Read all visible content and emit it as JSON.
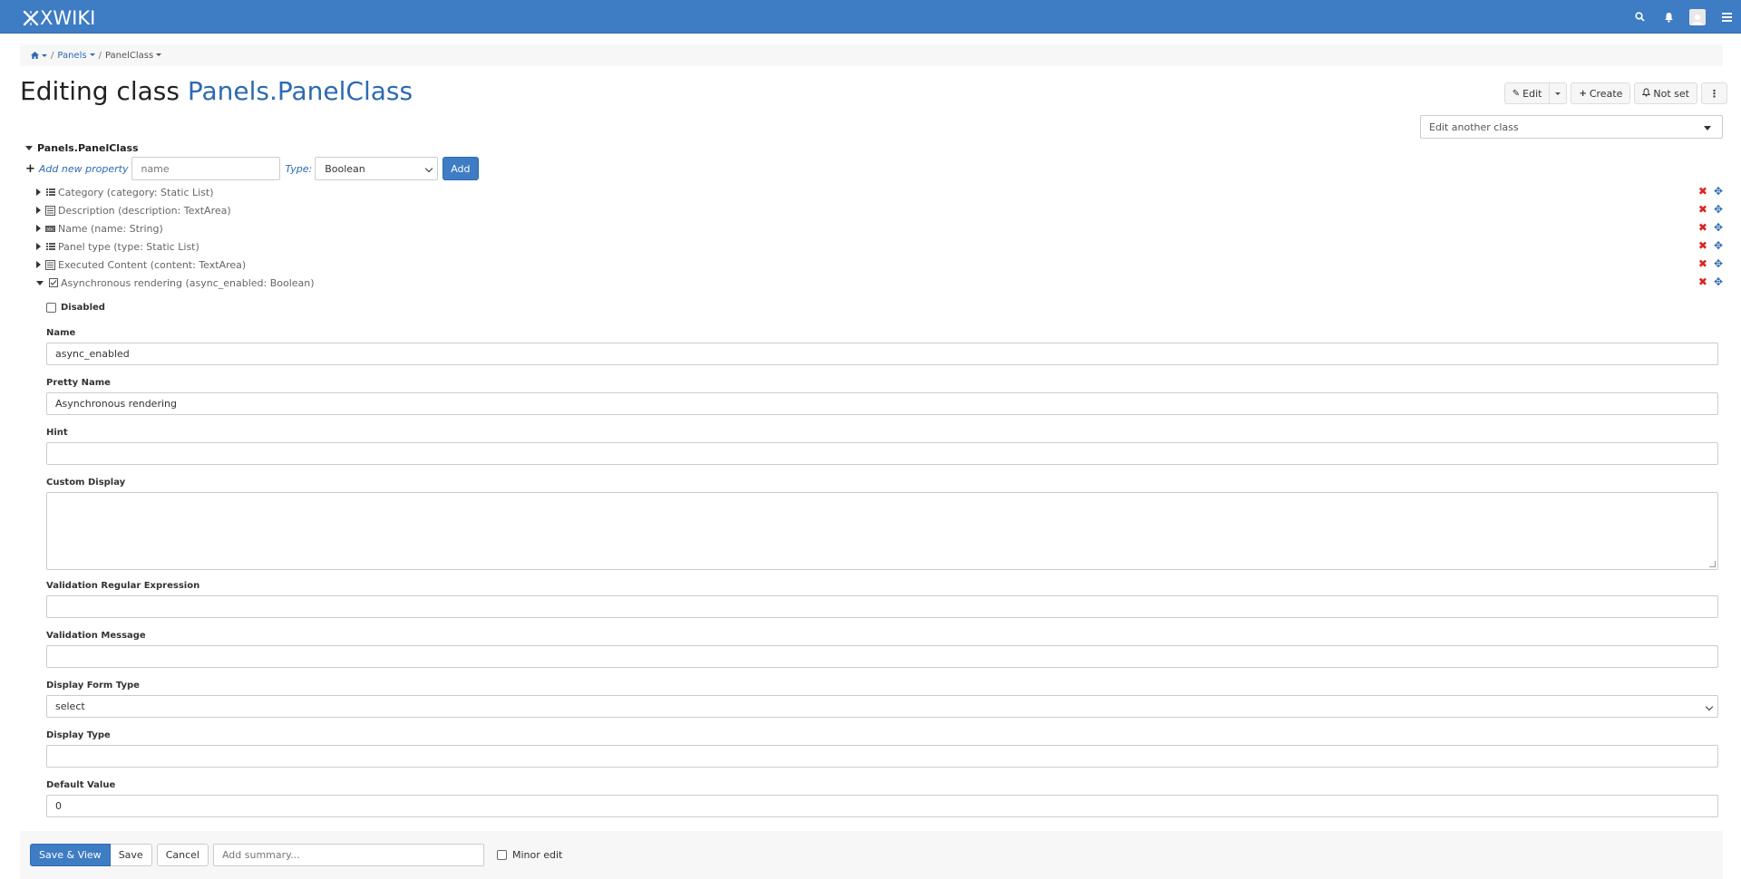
{
  "brand": "XWIKI",
  "breadcrumb": {
    "space": "Panels",
    "page": "PanelClass"
  },
  "title": {
    "prefix": "Editing class",
    "class_name": "Panels.PanelClass"
  },
  "actions": {
    "edit": "Edit",
    "create": "Create",
    "notify": "Not set"
  },
  "edit_another": "Edit another class",
  "class_root": "Panels.PanelClass",
  "add_property": {
    "link": "Add new property",
    "placeholder": "name",
    "type_label": "Type:",
    "type_value": "Boolean",
    "add": "Add"
  },
  "properties": [
    {
      "label": "Category (category: Static List)",
      "icon": "list-icon"
    },
    {
      "label": "Description (description: TextArea)",
      "icon": "textarea-icon"
    },
    {
      "label": "Name (name: String)",
      "icon": "string-icon"
    },
    {
      "label": "Panel type (type: Static List)",
      "icon": "list-icon"
    },
    {
      "label": "Executed Content (content: TextArea)",
      "icon": "textarea-icon"
    },
    {
      "label": "Asynchronous rendering (async_enabled: Boolean)",
      "icon": "boolean-icon"
    }
  ],
  "form": {
    "disabled": "Disabled",
    "name_label": "Name",
    "name_value": "async_enabled",
    "pretty_label": "Pretty Name",
    "pretty_value": "Asynchronous rendering",
    "hint_label": "Hint",
    "custom_label": "Custom Display",
    "regex_label": "Validation Regular Expression",
    "message_label": "Validation Message",
    "form_type_label": "Display Form Type",
    "form_type_value": "select",
    "display_type_label": "Display Type",
    "default_label": "Default Value",
    "default_value": "0"
  },
  "footer": {
    "save_view": "Save & View",
    "save": "Save",
    "cancel": "Cancel",
    "summary_placeholder": "Add summary...",
    "minor_edit": "Minor edit"
  },
  "colors": {
    "topbar": "#3e7cc3",
    "link": "#2d6ab0",
    "delete": "#dd2222"
  }
}
